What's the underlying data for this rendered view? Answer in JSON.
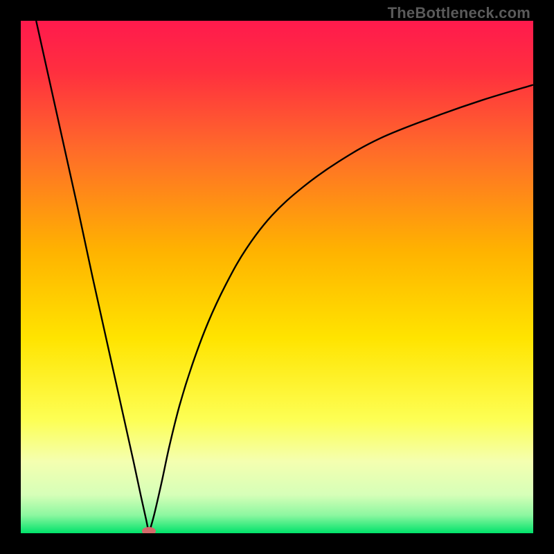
{
  "watermark": "TheBottleneck.com",
  "colors": {
    "frame": "#000000",
    "curve": "#000000",
    "marker": "#d46a6a",
    "gradient_stops": [
      {
        "offset": 0.0,
        "color": "#ff1a4d"
      },
      {
        "offset": 0.1,
        "color": "#ff2f3f"
      },
      {
        "offset": 0.25,
        "color": "#ff6a2a"
      },
      {
        "offset": 0.45,
        "color": "#ffb300"
      },
      {
        "offset": 0.62,
        "color": "#ffe400"
      },
      {
        "offset": 0.78,
        "color": "#fdff55"
      },
      {
        "offset": 0.86,
        "color": "#f4ffb0"
      },
      {
        "offset": 0.925,
        "color": "#d6ffb8"
      },
      {
        "offset": 0.965,
        "color": "#8cf7a0"
      },
      {
        "offset": 1.0,
        "color": "#00e26a"
      }
    ]
  },
  "chart_data": {
    "type": "line",
    "title": "",
    "xlabel": "",
    "ylabel": "",
    "xlim": [
      0,
      100
    ],
    "ylim": [
      0,
      100
    ],
    "legend": false,
    "grid": false,
    "minimum": {
      "x": 25,
      "y": 0
    },
    "series": [
      {
        "name": "left-branch",
        "x": [
          3,
          5,
          8,
          11,
          14,
          17,
          20,
          22,
          23.5,
          24.5,
          25
        ],
        "y": [
          100,
          91,
          77.5,
          64,
          50,
          36.5,
          23,
          14,
          7,
          2.5,
          0
        ]
      },
      {
        "name": "right-branch",
        "x": [
          25,
          26,
          27.5,
          29,
          31,
          33.5,
          36.5,
          40,
          44,
          49,
          55,
          62,
          70,
          80,
          90,
          100
        ],
        "y": [
          0,
          3.5,
          10,
          17,
          25,
          33,
          41,
          48.5,
          55.5,
          62,
          67.5,
          72.5,
          77,
          81,
          84.5,
          87.5
        ]
      }
    ]
  }
}
